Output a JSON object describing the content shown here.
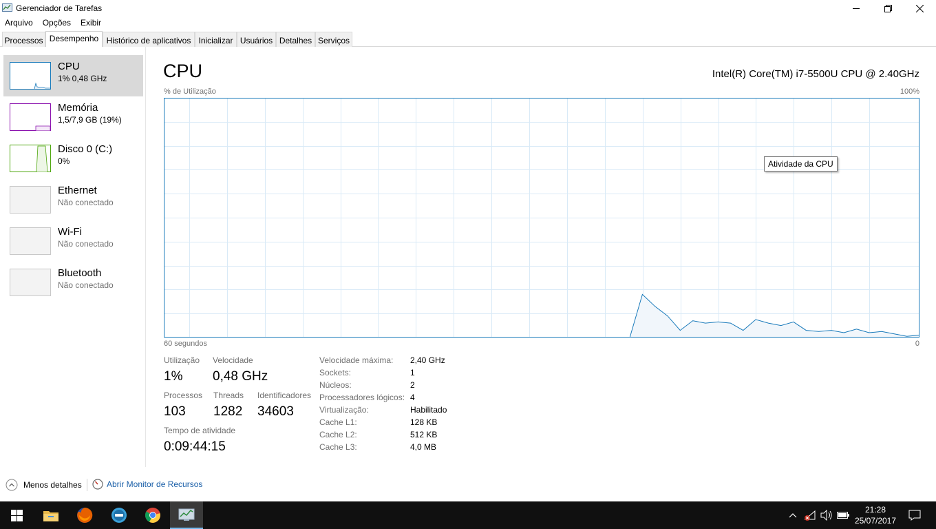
{
  "window": {
    "title": "Gerenciador de Tarefas",
    "minimize_icon": "minimize-icon",
    "maximize_icon": "maximize-icon",
    "close_icon": "close-icon"
  },
  "menu": [
    "Arquivo",
    "Opções",
    "Exibir"
  ],
  "tabs": [
    "Processos",
    "Desempenho",
    "Histórico de aplicativos",
    "Inicializar",
    "Usuários",
    "Detalhes",
    "Serviços"
  ],
  "active_tab": "Desempenho",
  "sidebar": {
    "items": [
      {
        "title": "CPU",
        "sub": "1% 0,48 GHz",
        "color": "#1779ba"
      },
      {
        "title": "Memória",
        "sub": "1,5/7,9 GB (19%)",
        "color": "#8b12ae"
      },
      {
        "title": "Disco 0 (C:)",
        "sub": "0%",
        "color": "#4da60c"
      },
      {
        "title": "Ethernet",
        "sub": "Não conectado"
      },
      {
        "title": "Wi-Fi",
        "sub": "Não conectado"
      },
      {
        "title": "Bluetooth",
        "sub": "Não conectado"
      }
    ]
  },
  "main": {
    "title": "CPU",
    "cpu_model": "Intel(R) Core(TM) i7-5500U CPU @ 2.40GHz",
    "chart_ylabel": "% de Utilização",
    "chart_ymax_label": "100%",
    "chart_xlabel": "60 segundos",
    "chart_xmin_label": "0",
    "tooltip": "Atividade da CPU",
    "stats": {
      "utilizacao_label": "Utilização",
      "utilizacao": "1%",
      "velocidade_label": "Velocidade",
      "velocidade": "0,48 GHz",
      "processos_label": "Processos",
      "processos": "103",
      "threads_label": "Threads",
      "threads": "1282",
      "identificadores_label": "Identificadores",
      "identificadores": "34603",
      "tempo_label": "Tempo de atividade",
      "tempo": "0:09:44:15"
    },
    "specs": [
      {
        "key": "Velocidade máxima:",
        "value": "2,40 GHz"
      },
      {
        "key": "Sockets:",
        "value": "1"
      },
      {
        "key": "Núcleos:",
        "value": "2"
      },
      {
        "key": "Processadores lógicos:",
        "value": "4"
      },
      {
        "key": "Virtualização:",
        "value": "Habilitado"
      },
      {
        "key": "Cache L1:",
        "value": "128 KB"
      },
      {
        "key": "Cache L2:",
        "value": "512 KB"
      },
      {
        "key": "Cache L3:",
        "value": "4,0 MB"
      }
    ]
  },
  "chart_data": {
    "type": "area",
    "ylabel": "% de Utilização",
    "ylim": [
      0,
      100
    ],
    "xlabel": "60 segundos",
    "xlim": [
      60,
      0
    ],
    "grid": true,
    "color": "#1779ba",
    "x": [
      23,
      22,
      21,
      20,
      19,
      18,
      17,
      16,
      15,
      14,
      13,
      12,
      11,
      10,
      9,
      8,
      7,
      6,
      5,
      4,
      3,
      2,
      1,
      0
    ],
    "y": [
      0,
      18,
      13,
      9,
      3,
      7,
      6,
      6.5,
      6,
      3,
      7.5,
      6,
      5,
      6.5,
      3,
      2.5,
      3,
      2,
      3.5,
      2,
      2.5,
      1.5,
      0.5,
      1
    ]
  },
  "footer": {
    "less_details": "Menos detalhes",
    "resource_monitor": "Abrir Monitor de Recursos"
  },
  "taskbar": {
    "icons": [
      "windows-start-icon",
      "file-explorer-icon",
      "firefox-icon",
      "app-icon",
      "chrome-icon",
      "task-manager-icon"
    ],
    "time": "21:28",
    "date": "25/07/2017"
  }
}
